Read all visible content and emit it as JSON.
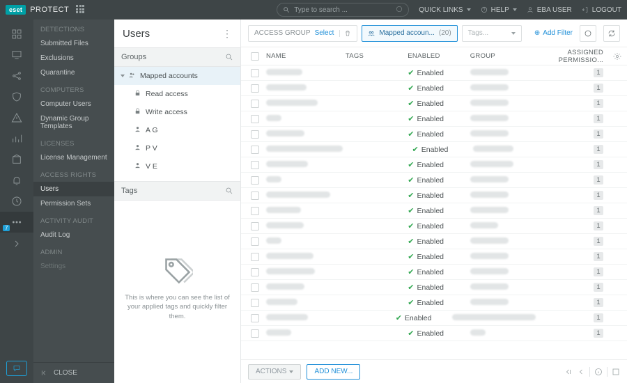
{
  "header": {
    "brand_badge": "eset",
    "brand_name": "PROTECT",
    "search_placeholder": "Type to search ...",
    "quick_links": "QUICK LINKS",
    "help": "HELP",
    "user": "EBA USER",
    "logout": "LOGOUT"
  },
  "nav2": {
    "sections": [
      {
        "title": "DETECTIONS",
        "items": [
          "Submitted Files",
          "Exclusions",
          "Quarantine"
        ]
      },
      {
        "title": "COMPUTERS",
        "items": [
          "Computer Users",
          "Dynamic Group Templates"
        ]
      },
      {
        "title": "LICENSES",
        "items": [
          "License Management"
        ]
      },
      {
        "title": "ACCESS RIGHTS",
        "items": [
          "Users",
          "Permission Sets"
        ],
        "selected": "Users"
      },
      {
        "title": "ACTIVITY AUDIT",
        "items": [
          "Audit Log"
        ]
      },
      {
        "title": "ADMIN",
        "items": [
          "Settings"
        ]
      }
    ],
    "close": "CLOSE"
  },
  "users_panel": {
    "title": "Users",
    "groups_label": "Groups",
    "tree": [
      {
        "label": "Mapped accounts",
        "icon": "people",
        "selected": true
      },
      {
        "label": "Read access",
        "icon": "lock",
        "indent": 1
      },
      {
        "label": "Write access",
        "icon": "lock",
        "indent": 1
      },
      {
        "label": "A G",
        "icon": "person",
        "indent": 1
      },
      {
        "label": "P V",
        "icon": "person",
        "indent": 1
      },
      {
        "label": "V E",
        "icon": "person",
        "indent": 1
      }
    ],
    "tags_label": "Tags",
    "tags_empty": "This is where you can see the list of your applied tags and quickly filter them."
  },
  "filters": {
    "access_group": "ACCESS GROUP",
    "select": "Select",
    "mapped_chip": "Mapped accoun...",
    "mapped_count": "(20)",
    "tags_placeholder": "Tags...",
    "add_filter": "Add Filter"
  },
  "table": {
    "headers": [
      "NAME",
      "TAGS",
      "ENABLED",
      "GROUP",
      "ASSIGNED PERMISSIO..."
    ],
    "enabled_label": "Enabled",
    "rows_count": 18,
    "perm_value": "1"
  },
  "footer": {
    "actions": "ACTIONS",
    "add_new": "ADD NEW..."
  },
  "rail_badge": "7"
}
